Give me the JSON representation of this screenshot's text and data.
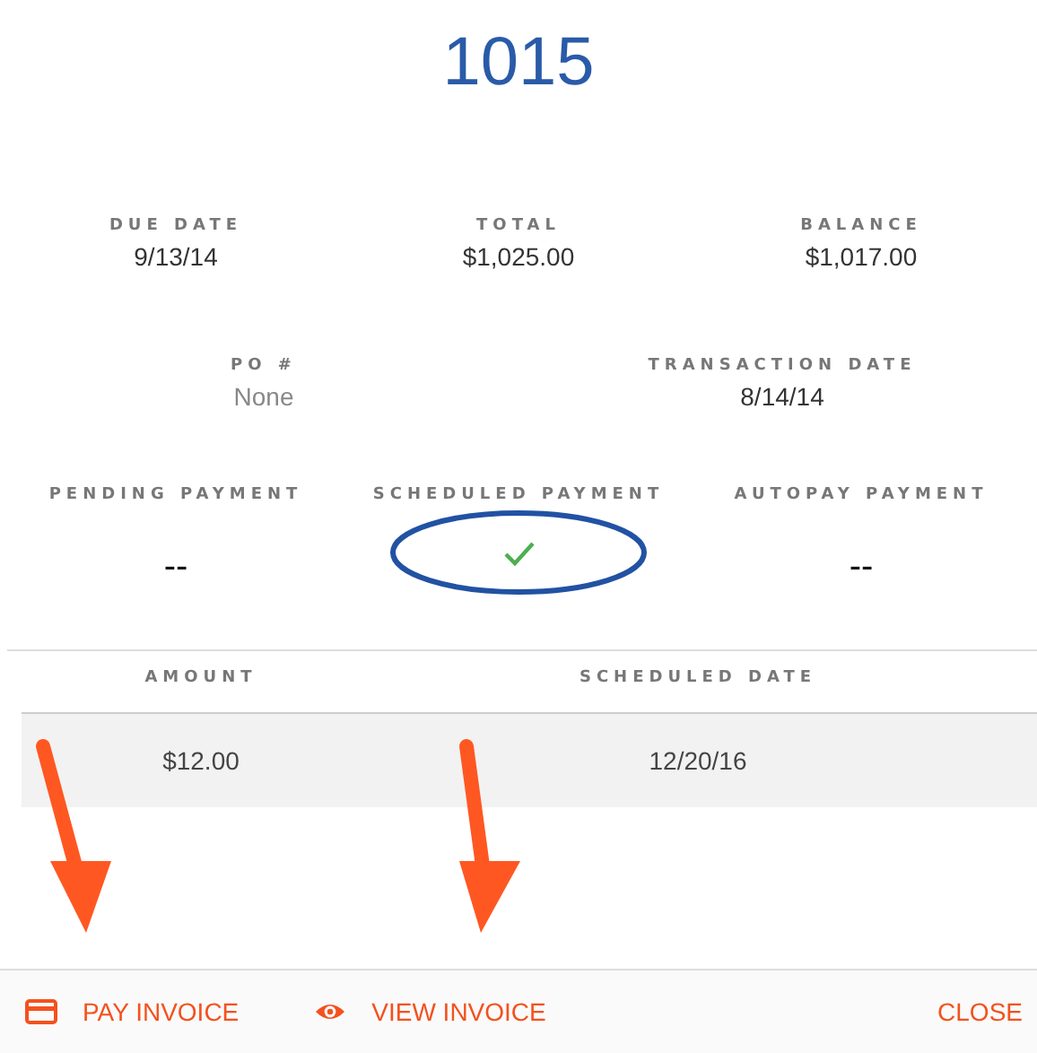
{
  "title": "1015",
  "summary": [
    {
      "label": "DUE DATE",
      "value": "9/13/14"
    },
    {
      "label": "TOTAL",
      "value": "$1,025.00"
    },
    {
      "label": "BALANCE",
      "value": "$1,017.00"
    }
  ],
  "details": [
    {
      "label": "PO #",
      "value": "None",
      "muted": true
    },
    {
      "label": "TRANSACTION DATE",
      "value": "8/14/14",
      "muted": false
    }
  ],
  "payments": [
    {
      "label": "PENDING PAYMENT",
      "kind": "text",
      "value": "--"
    },
    {
      "label": "SCHEDULED PAYMENT",
      "kind": "check",
      "highlighted": true
    },
    {
      "label": "AUTOPAY PAYMENT",
      "kind": "text",
      "value": "--"
    }
  ],
  "table": {
    "columns": [
      "AMOUNT",
      "SCHEDULED DATE"
    ],
    "rows": [
      [
        "$12.00",
        "12/20/16"
      ]
    ]
  },
  "footer": [
    {
      "kind": "card",
      "label": "PAY INVOICE",
      "arrow": true
    },
    {
      "kind": "eye",
      "label": "VIEW INVOICE",
      "arrow": true
    },
    {
      "kind": "plain",
      "label": "CLOSE",
      "arrow": false
    }
  ]
}
